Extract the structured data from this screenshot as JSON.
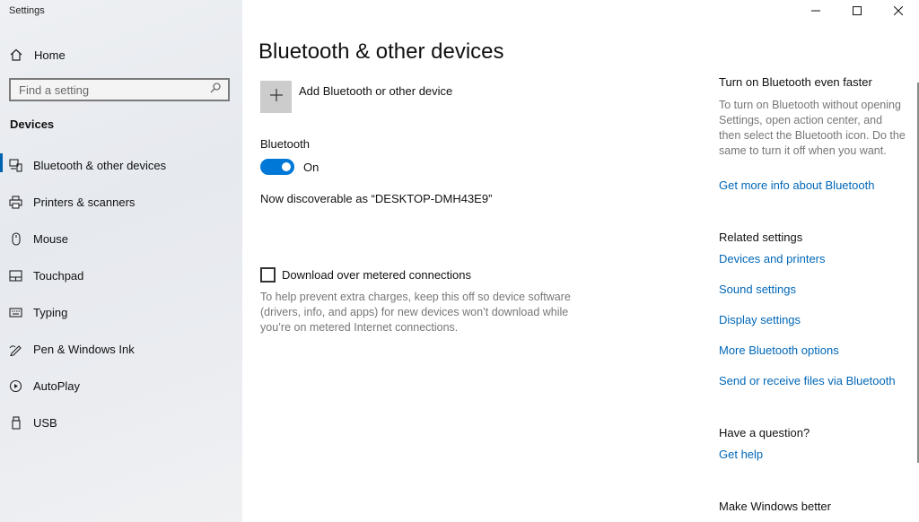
{
  "window": {
    "title": "Settings",
    "controls": {
      "minimize": "minimize-icon",
      "maximize": "maximize-icon",
      "close": "close-icon"
    }
  },
  "sidebar": {
    "home_label": "Home",
    "search_placeholder": "Find a setting",
    "section_title": "Devices",
    "items": [
      {
        "label": "Bluetooth & other devices",
        "icon": "bluetooth-devices-icon",
        "active": true
      },
      {
        "label": "Printers & scanners",
        "icon": "printer-icon",
        "active": false
      },
      {
        "label": "Mouse",
        "icon": "mouse-icon",
        "active": false
      },
      {
        "label": "Touchpad",
        "icon": "touchpad-icon",
        "active": false
      },
      {
        "label": "Typing",
        "icon": "keyboard-icon",
        "active": false
      },
      {
        "label": "Pen & Windows Ink",
        "icon": "pen-icon",
        "active": false
      },
      {
        "label": "AutoPlay",
        "icon": "autoplay-icon",
        "active": false
      },
      {
        "label": "USB",
        "icon": "usb-icon",
        "active": false
      }
    ]
  },
  "main": {
    "title": "Bluetooth & other devices",
    "add_device_label": "Add Bluetooth or other device",
    "bluetooth_label": "Bluetooth",
    "bluetooth_state": "On",
    "bluetooth_on": true,
    "discoverable_text": "Now discoverable as “DESKTOP-DMH43E9”",
    "metered_label": "Download over metered connections",
    "metered_checked": false,
    "metered_help": "To help prevent extra charges, keep this off so device software (drivers, info, and apps) for new devices won’t download while you’re on metered Internet connections."
  },
  "right_panel": {
    "faster_title": "Turn on Bluetooth even faster",
    "faster_text": "To turn on Bluetooth without opening Settings, open action center, and then select the Bluetooth icon. Do the same to turn it off when you want.",
    "faster_link": "Get more info about Bluetooth",
    "related_title": "Related settings",
    "related_links": [
      "Devices and printers",
      "Sound settings",
      "Display settings",
      "More Bluetooth options",
      "Send or receive files via Bluetooth"
    ],
    "question_title": "Have a question?",
    "question_link": "Get help",
    "better_title": "Make Windows better"
  },
  "colors": {
    "accent": "#0078d7",
    "link": "#0067b8",
    "sidebar_bg": "#e9ebef"
  }
}
